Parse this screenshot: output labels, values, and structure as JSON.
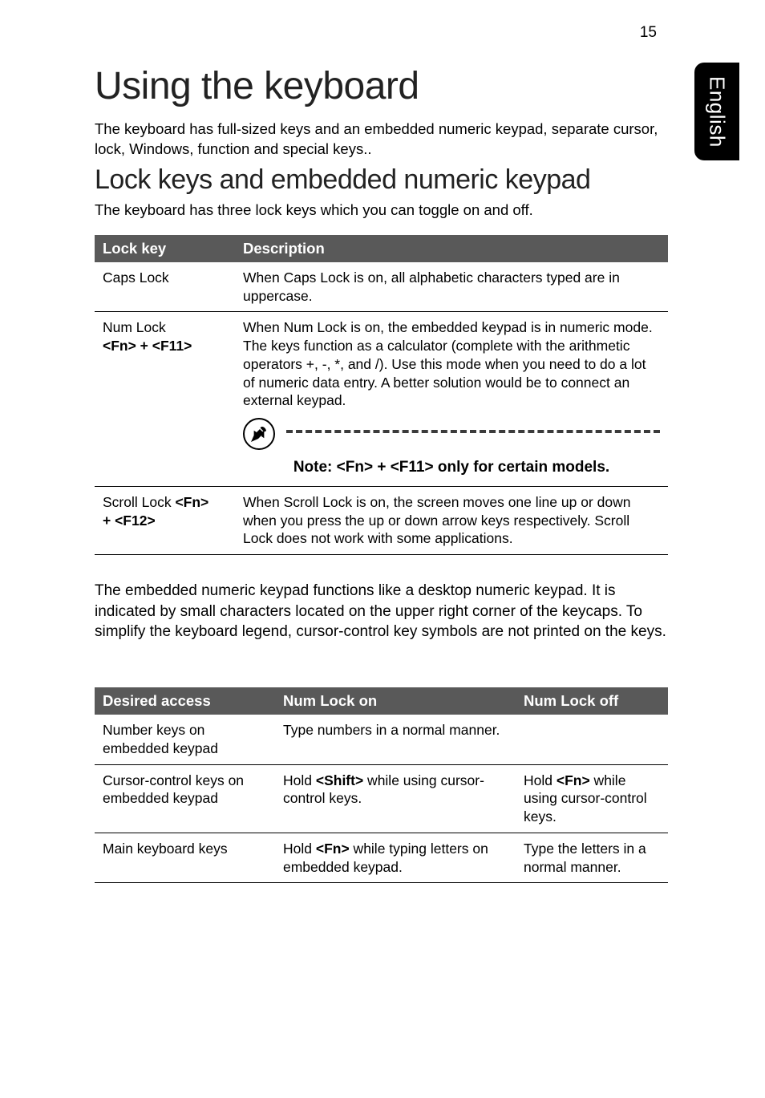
{
  "page_number": "15",
  "side_tab": "English",
  "title": "Using the keyboard",
  "intro": "The keyboard has full-sized keys and an embedded numeric keypad, separate cursor, lock, Windows, function and special keys..",
  "section1_title": "Lock keys and embedded numeric keypad",
  "section1_sub": "The keyboard has three lock keys which you can toggle on and off.",
  "table1": {
    "headers": {
      "col1": "Lock key",
      "col2": "Description"
    },
    "rows": [
      {
        "key": "Caps Lock",
        "desc": "When Caps Lock is on, all alphabetic characters typed are in uppercase."
      },
      {
        "key": "Num Lock <Fn> + <F11>",
        "key_line1": "Num Lock",
        "key_line2": "<Fn> + <F11>",
        "desc": "When Num Lock is on, the embedded keypad is in numeric mode. The keys function as a calculator (complete with the arithmetic operators +, -, *, and /). Use this mode when you need to do a lot of numeric data entry. A better solution would be to connect an external keypad.",
        "note": "Note: <Fn> + <F11> only for certain models."
      },
      {
        "key": "Scroll Lock <Fn> + <F12>",
        "key_line1": "Scroll Lock <Fn>",
        "key_line2": "+ <F12>",
        "desc": "When Scroll Lock is on, the screen moves one line up or down when you press the up or down arrow keys respectively. Scroll Lock does not work with some applications."
      }
    ]
  },
  "mid_paragraph": "The embedded numeric keypad functions like a desktop numeric keypad. It is indicated by small characters located on the upper right corner of the keycaps. To simplify the keyboard legend, cursor-control key symbols are not printed on the keys.",
  "table2": {
    "headers": {
      "col1": "Desired access",
      "col2": "Num Lock on",
      "col3": "Num Lock off"
    },
    "rows": [
      {
        "access": "Number keys on embedded keypad",
        "on": "Type numbers in a normal manner.",
        "off": ""
      },
      {
        "access": "Cursor-control keys on embedded keypad",
        "on_pre": "Hold ",
        "on_bold": "<Shift>",
        "on_post": " while using cursor-control keys.",
        "off_pre": "Hold ",
        "off_bold": "<Fn>",
        "off_post": " while using cursor-control keys."
      },
      {
        "access": "Main keyboard keys",
        "on_pre": "Hold ",
        "on_bold": "<Fn>",
        "on_post": " while typing letters on embedded keypad.",
        "off": "Type the letters in a normal manner."
      }
    ]
  }
}
